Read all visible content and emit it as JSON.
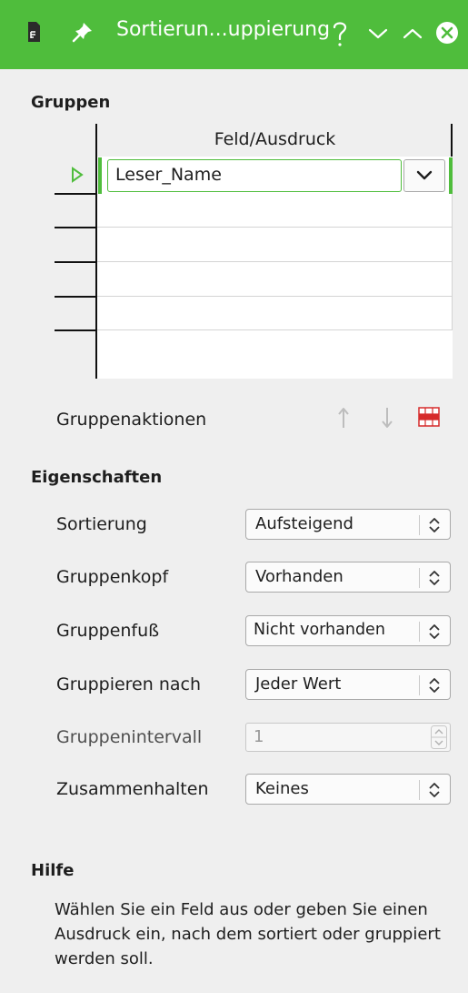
{
  "window": {
    "title": "Sortierun...uppierung",
    "titlebar_color": "#4fbd3c",
    "icons": [
      "document-icon",
      "pin-icon",
      "help-icon",
      "minimize-icon",
      "maximize-icon",
      "close-icon"
    ]
  },
  "groups": {
    "heading": "Gruppen",
    "column_header": "Feld/Ausdruck",
    "rows": [
      {
        "value": "Leser_Name"
      },
      {
        "value": ""
      },
      {
        "value": ""
      },
      {
        "value": ""
      },
      {
        "value": ""
      }
    ],
    "actions_label": "Gruppenaktionen"
  },
  "properties": {
    "heading": "Eigenschaften",
    "sort_label": "Sortierung",
    "sort_value": "Aufsteigend",
    "header_label": "Gruppenkopf",
    "header_value": "Vorhanden",
    "footer_label": "Gruppenfuß",
    "footer_value": "Nicht vorhanden",
    "groupby_label": "Gruppieren nach",
    "groupby_value": "Jeder Wert",
    "interval_label": "Gruppenintervall",
    "interval_value": "1",
    "keep_label": "Zusammenhalten",
    "keep_value": "Keines"
  },
  "help": {
    "heading": "Hilfe",
    "text": "Wählen Sie ein Feld aus oder geben Sie einen Ausdruck ein, nach dem sortiert oder gruppiert werden soll."
  }
}
